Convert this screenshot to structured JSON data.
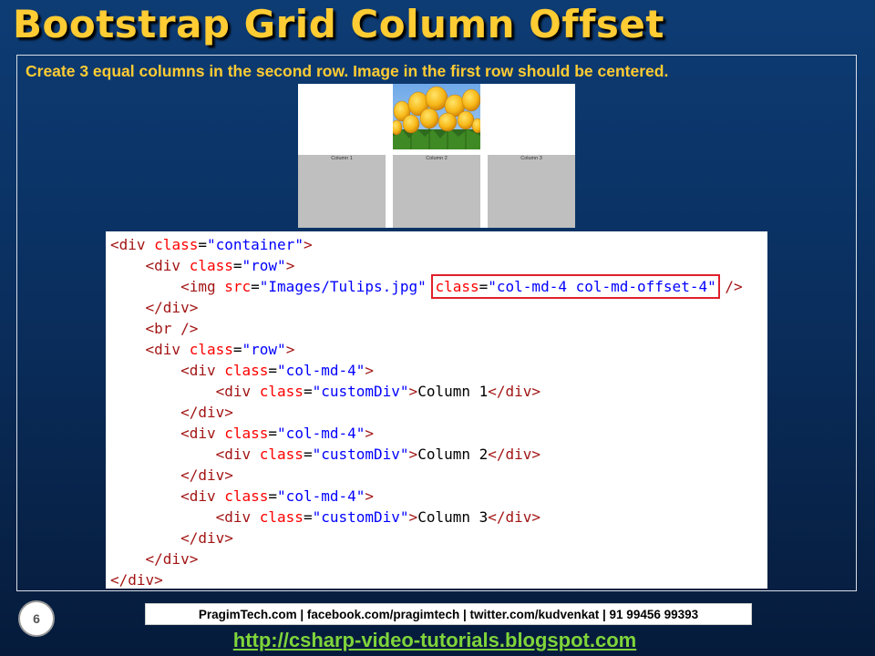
{
  "slide": {
    "title": "Bootstrap Grid Column Offset",
    "instruction": "Create 3 equal columns in the second row. Image in the first row should be centered.",
    "number": "6"
  },
  "preview": {
    "image_alt": "Tulips",
    "columns": [
      "Column 1",
      "Column 2",
      "Column 3"
    ],
    "colors": {
      "column_bg": "#bfbfbf",
      "background": "#ffffff"
    }
  },
  "code": {
    "colors": {
      "tag": "#a31515",
      "attribute": "#ff0000",
      "value": "#0000ff",
      "highlight_box": "#e0202a"
    },
    "lines": [
      {
        "indent": 0,
        "tokens": [
          [
            "tg",
            "<div "
          ],
          [
            "at",
            "class"
          ],
          [
            "tx",
            "="
          ],
          [
            "vl",
            "\"container\""
          ],
          [
            "tg",
            ">"
          ]
        ]
      },
      {
        "indent": 1,
        "tokens": [
          [
            "tg",
            "<div "
          ],
          [
            "at",
            "class"
          ],
          [
            "tx",
            "="
          ],
          [
            "vl",
            "\"row\""
          ],
          [
            "tg",
            ">"
          ]
        ]
      },
      {
        "indent": 2,
        "tokens": [
          [
            "tg",
            "<img "
          ],
          [
            "at",
            "src"
          ],
          [
            "tx",
            "="
          ],
          [
            "vl",
            "\"Images/Tulips.jpg\""
          ],
          [
            "tx",
            " "
          ],
          [
            "hl-at",
            "class"
          ],
          [
            "hl-tx",
            "="
          ],
          [
            "hl-vl",
            "\"col-md-4 col-md-offset-4\""
          ],
          [
            "tx",
            " "
          ],
          [
            "tg",
            "/>"
          ]
        ]
      },
      {
        "indent": 1,
        "tokens": [
          [
            "tg",
            "</div>"
          ]
        ]
      },
      {
        "indent": 1,
        "tokens": [
          [
            "tg",
            "<br />"
          ]
        ]
      },
      {
        "indent": 1,
        "tokens": [
          [
            "tg",
            "<div "
          ],
          [
            "at",
            "class"
          ],
          [
            "tx",
            "="
          ],
          [
            "vl",
            "\"row\""
          ],
          [
            "tg",
            ">"
          ]
        ]
      },
      {
        "indent": 2,
        "tokens": [
          [
            "tg",
            "<div "
          ],
          [
            "at",
            "class"
          ],
          [
            "tx",
            "="
          ],
          [
            "vl",
            "\"col-md-4\""
          ],
          [
            "tg",
            ">"
          ]
        ]
      },
      {
        "indent": 3,
        "tokens": [
          [
            "tg",
            "<div "
          ],
          [
            "at",
            "class"
          ],
          [
            "tx",
            "="
          ],
          [
            "vl",
            "\"customDiv\""
          ],
          [
            "tg",
            ">"
          ],
          [
            "tx",
            "Column 1"
          ],
          [
            "tg",
            "</div>"
          ]
        ]
      },
      {
        "indent": 2,
        "tokens": [
          [
            "tg",
            "</div>"
          ]
        ]
      },
      {
        "indent": 2,
        "tokens": [
          [
            "tg",
            "<div "
          ],
          [
            "at",
            "class"
          ],
          [
            "tx",
            "="
          ],
          [
            "vl",
            "\"col-md-4\""
          ],
          [
            "tg",
            ">"
          ]
        ]
      },
      {
        "indent": 3,
        "tokens": [
          [
            "tg",
            "<div "
          ],
          [
            "at",
            "class"
          ],
          [
            "tx",
            "="
          ],
          [
            "vl",
            "\"customDiv\""
          ],
          [
            "tg",
            ">"
          ],
          [
            "tx",
            "Column 2"
          ],
          [
            "tg",
            "</div>"
          ]
        ]
      },
      {
        "indent": 2,
        "tokens": [
          [
            "tg",
            "</div>"
          ]
        ]
      },
      {
        "indent": 2,
        "tokens": [
          [
            "tg",
            "<div "
          ],
          [
            "at",
            "class"
          ],
          [
            "tx",
            "="
          ],
          [
            "vl",
            "\"col-md-4\""
          ],
          [
            "tg",
            ">"
          ]
        ]
      },
      {
        "indent": 3,
        "tokens": [
          [
            "tg",
            "<div "
          ],
          [
            "at",
            "class"
          ],
          [
            "tx",
            "="
          ],
          [
            "vl",
            "\"customDiv\""
          ],
          [
            "tg",
            ">"
          ],
          [
            "tx",
            "Column 3"
          ],
          [
            "tg",
            "</div>"
          ]
        ]
      },
      {
        "indent": 2,
        "tokens": [
          [
            "tg",
            "</div>"
          ]
        ]
      },
      {
        "indent": 1,
        "tokens": [
          [
            "tg",
            "</div>"
          ]
        ]
      },
      {
        "indent": 0,
        "tokens": [
          [
            "tg",
            "</div>"
          ]
        ]
      }
    ]
  },
  "footer": {
    "contact": "PragimTech.com | facebook.com/pragimtech  | twitter.com/kudvenkat  | 91 99456 99393",
    "link": "http://csharp-video-tutorials.blogspot.com"
  },
  "theme": {
    "title_color": "#ffcc33",
    "link_color": "#7fd43a",
    "bg_top": "#0d3c74",
    "bg_bottom": "#061b3b"
  }
}
